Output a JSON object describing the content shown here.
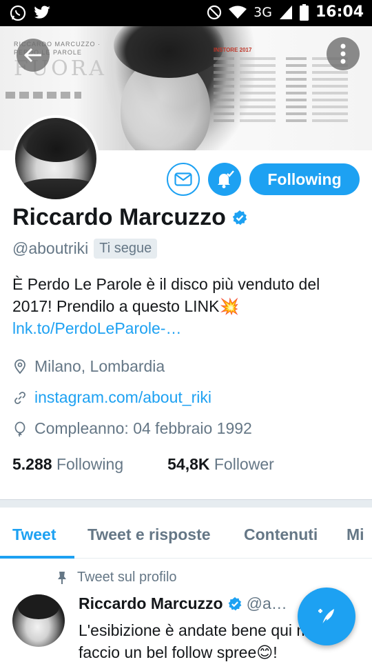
{
  "status_bar": {
    "left_icons": [
      "whatsapp-icon",
      "twitter-icon"
    ],
    "right_icons": [
      "dnd-icon",
      "wifi-icon",
      "signal-icon",
      "battery-icon"
    ],
    "network": "3G",
    "time": "16:04"
  },
  "banner": {
    "promo_top": "RICCARDO MARCUZZO · PERDO LE PAROLE",
    "promo_title": "FUORA",
    "tour_heading": "INSTORE 2017"
  },
  "profile": {
    "name": "Riccardo Marcuzzo",
    "verified": true,
    "handle": "@aboutriki",
    "follows_you": "Ti segue",
    "follow_button": "Following",
    "bio_text": "È Perdo Le Parole è il disco più venduto del 2017! Prendilo a questo LINK💥",
    "bio_link": "lnk.to/PerdoLeParole-…",
    "location": "Milano, Lombardia",
    "website": "instagram.com/about_riki",
    "birthday": "Compleanno: 04 febbraio 1992",
    "following_count": "5.288",
    "following_label": "Following",
    "followers_count": "54,8K",
    "followers_label": "Follower"
  },
  "tabs": [
    {
      "label": "Tweet",
      "active": true
    },
    {
      "label": "Tweet e risposte",
      "active": false
    },
    {
      "label": "Contenuti",
      "active": false
    },
    {
      "label": "Mi",
      "active": false
    }
  ],
  "pinned_tweet": {
    "pinned_label": "Tweet sul profilo",
    "author": "Riccardo Marcuzzo",
    "handle": "@a…",
    "text": "L'esibizione è andate bene qui mila RT faccio un bel follow spree😊!"
  },
  "colors": {
    "accent": "#1da1f2",
    "secondary_text": "#657786",
    "primary_text": "#14171a"
  }
}
